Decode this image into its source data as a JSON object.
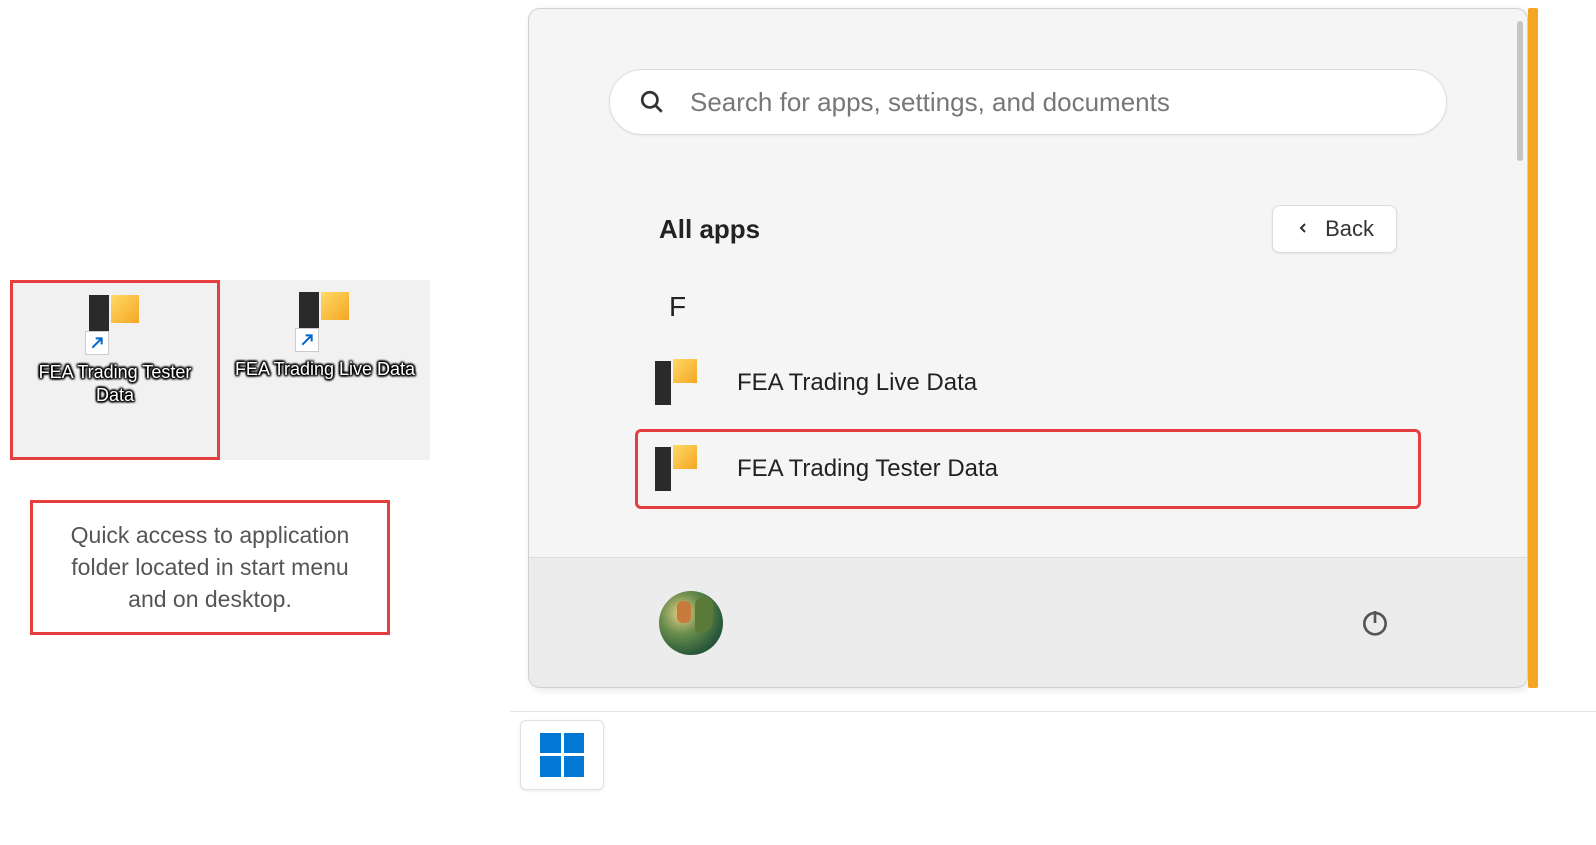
{
  "desktop": {
    "icons": [
      {
        "label": "FEA Trading Tester Data",
        "highlighted": true
      },
      {
        "label": "FEA Trading Live Data",
        "highlighted": false
      }
    ]
  },
  "caption": "Quick access to application folder located in start menu and on desktop.",
  "start_menu": {
    "search": {
      "placeholder": "Search for apps, settings, and documents"
    },
    "all_apps_label": "All apps",
    "back_label": "Back",
    "section_letter": "F",
    "apps": [
      {
        "label": "FEA Trading Live Data",
        "highlighted": false
      },
      {
        "label": "FEA Trading Tester Data",
        "highlighted": true
      }
    ]
  }
}
